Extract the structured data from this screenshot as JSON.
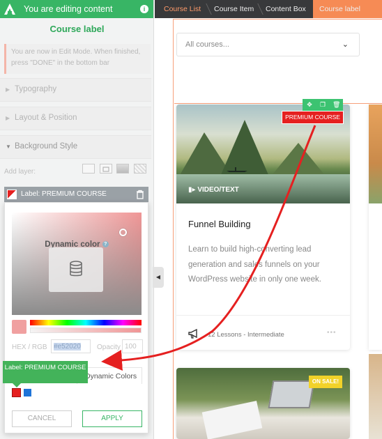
{
  "topbar": {
    "title": "You are editing content",
    "info_icon": "info-icon"
  },
  "panel": {
    "title": "Course label",
    "notice": "You are now in Edit Mode. When finished, press \"DONE\" in the bottom bar",
    "sections": [
      {
        "label": "Typography",
        "open": false
      },
      {
        "label": "Layout & Position",
        "open": false
      },
      {
        "label": "Background Style",
        "open": true
      }
    ],
    "add_layer_label": "Add layer:",
    "layer": {
      "label": "Label: PREMIUM COURSE"
    },
    "picker": {
      "dynamic_color_label": "Dynamic color",
      "hex_rgb_label": "HEX / RGB",
      "hex_value": "#e52020",
      "opacity_label": "Opacity",
      "opacity_value": "100",
      "tab_dynamic": "Dynamic Colors",
      "cancel_label": "CANCEL",
      "apply_label": "APPLY",
      "swatches": [
        "#e52020",
        "#1e74d8"
      ]
    },
    "tooltip": "Label: PREMIUM COURSE"
  },
  "breadcrumb": [
    "Course List",
    "Course Item",
    "Content Box",
    "Course label"
  ],
  "content": {
    "filter_placeholder": "All courses...",
    "card": {
      "media_type": "VIDEO/TEXT",
      "label": "PREMIUM COURSE",
      "title": "Funnel Building",
      "description": "Learn to build high-converting lead generation and sales funnels on your WordPress website in only one week.",
      "meta": "12 Lessons - Intermediate",
      "more": "•••"
    },
    "card2": {
      "badge": "ON SALE!"
    }
  },
  "colors": {
    "accent_green": "#38b565",
    "breadcrumb_active": "#f68b55",
    "premium_red": "#e52020",
    "sale_yellow": "#f2d229"
  }
}
